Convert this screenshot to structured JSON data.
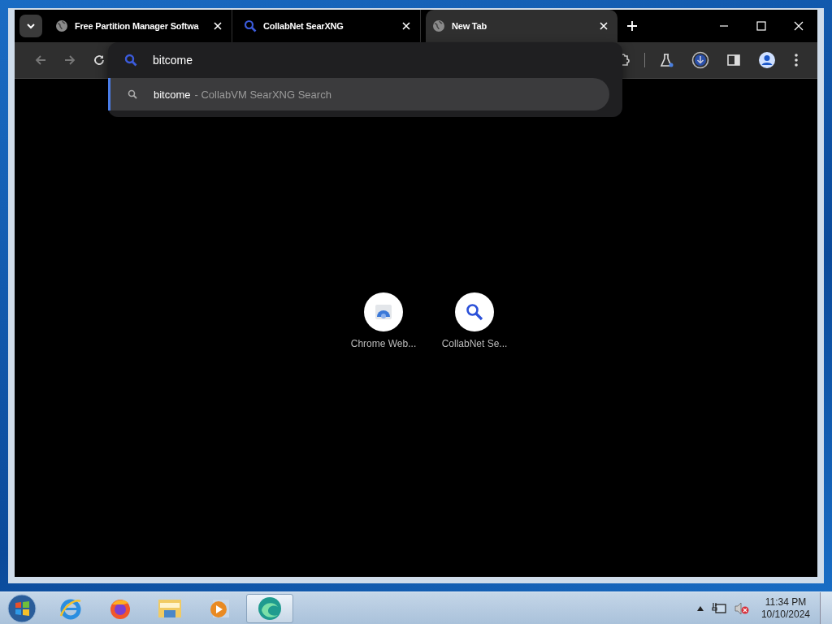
{
  "tabs": [
    {
      "title": "Free Partition Manager Softwa",
      "kind": "globe",
      "selected": false
    },
    {
      "title": "CollabNet SearXNG",
      "kind": "search",
      "selected": false
    },
    {
      "title": "New Tab",
      "kind": "globe",
      "selected": true
    }
  ],
  "omnibox": {
    "value": "bitcome",
    "suggestions": [
      {
        "query": "bitcome",
        "source": "- CollabVM SearXNG Search",
        "selected": true
      }
    ]
  },
  "shortcuts": [
    {
      "label": "Chrome Web...",
      "kind": "webstore"
    },
    {
      "label": "CollabNet Se...",
      "kind": "search"
    }
  ],
  "taskbar": {
    "apps": [
      {
        "kind": "ie",
        "active": false
      },
      {
        "kind": "firefox",
        "active": false
      },
      {
        "kind": "folder",
        "active": false
      },
      {
        "kind": "media",
        "active": false
      },
      {
        "kind": "edge",
        "active": true
      }
    ],
    "time": "11:34 PM",
    "date": "10/10/2024"
  }
}
